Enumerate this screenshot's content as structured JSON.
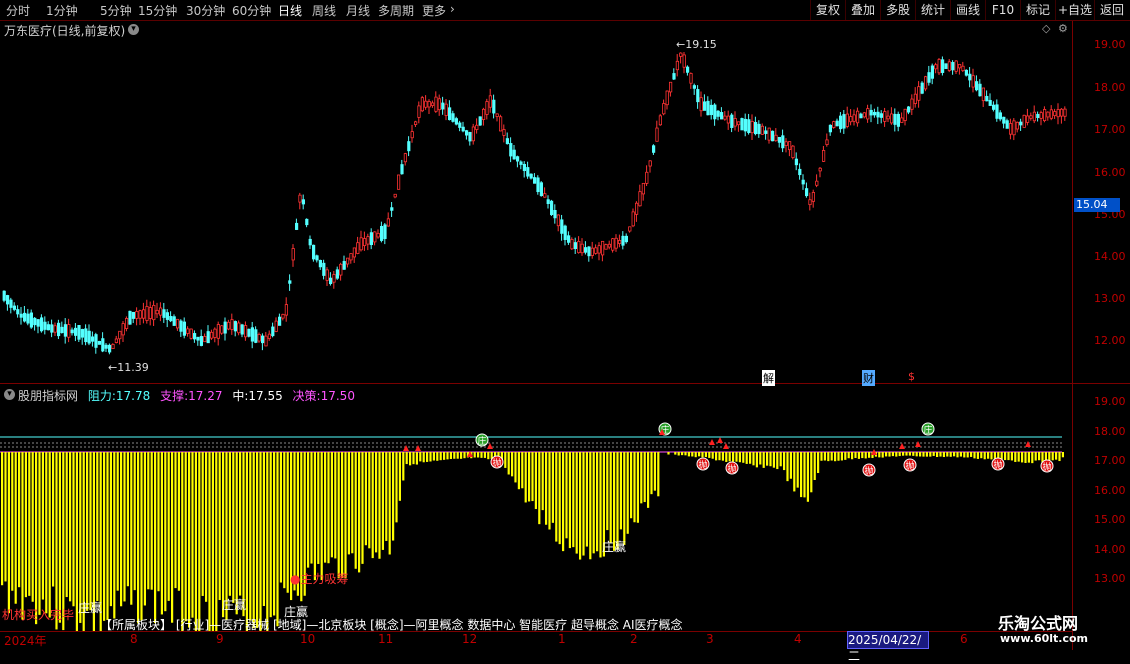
{
  "toolbar": {
    "periods": [
      "分时",
      "1分钟",
      "5分钟",
      "15分钟",
      "30分钟",
      "60分钟",
      "日线",
      "周线",
      "月线",
      "多周期",
      "更多"
    ],
    "more_icon": "chevron-right-icon",
    "right_buttons": [
      "复权",
      "叠加",
      "多股",
      "统计",
      "画线",
      "F10",
      "标记",
      "+自选",
      "返回"
    ]
  },
  "main_chart": {
    "title": "万东医疗(日线,前复权)",
    "high_label": "19.15",
    "low_label": "11.39",
    "current_price": "15.04",
    "y_ticks": [
      "19.00",
      "18.00",
      "17.00",
      "16.00",
      "15.00",
      "14.00",
      "13.00",
      "12.00"
    ],
    "event_markers": [
      "解",
      "财",
      "$"
    ]
  },
  "indicator": {
    "name": "股朋指标网",
    "resist_label": "阻力:",
    "resist_value": "17.78",
    "support_label": "支撑:",
    "support_value": "17.27",
    "mid_label": "中:",
    "mid_value": "17.55",
    "decision_label": "决策:",
    "decision_value": "17.50",
    "y_ticks": [
      "19.00",
      "18.00",
      "17.00",
      "16.00",
      "15.00",
      "14.00",
      "13.00"
    ],
    "annotations": {
      "main_absorb": "主力吸筹",
      "inst_buy": "机构买入完毕",
      "zhuang1": "庄赢",
      "zhuang2": "庄赢",
      "zhuang3": "庄赢",
      "zhuang4": "庄赢",
      "green_marker": "庄",
      "red_marker": "抛"
    },
    "info_line": "【所属板块】 [行业]—医疗器械 [地域]—北京板块 [概念]—阿里概念 数据中心 智能医疗 超导概念 AI医疗概念"
  },
  "date_axis": {
    "labels": [
      "2024年",
      "8",
      "9",
      "10",
      "11",
      "12",
      "1",
      "2",
      "3",
      "4",
      "6"
    ],
    "cursor_date": "2025/04/22/二"
  },
  "watermark": {
    "name": "乐淘公式网",
    "url": "www.60lt.com"
  },
  "colors": {
    "up": "#ff3333",
    "down": "#54ffff",
    "bar": "#ffff00",
    "axis": "#c00000",
    "resist": "#55ffff",
    "support": "#ff55ff",
    "decision": "#ff55ff"
  }
}
